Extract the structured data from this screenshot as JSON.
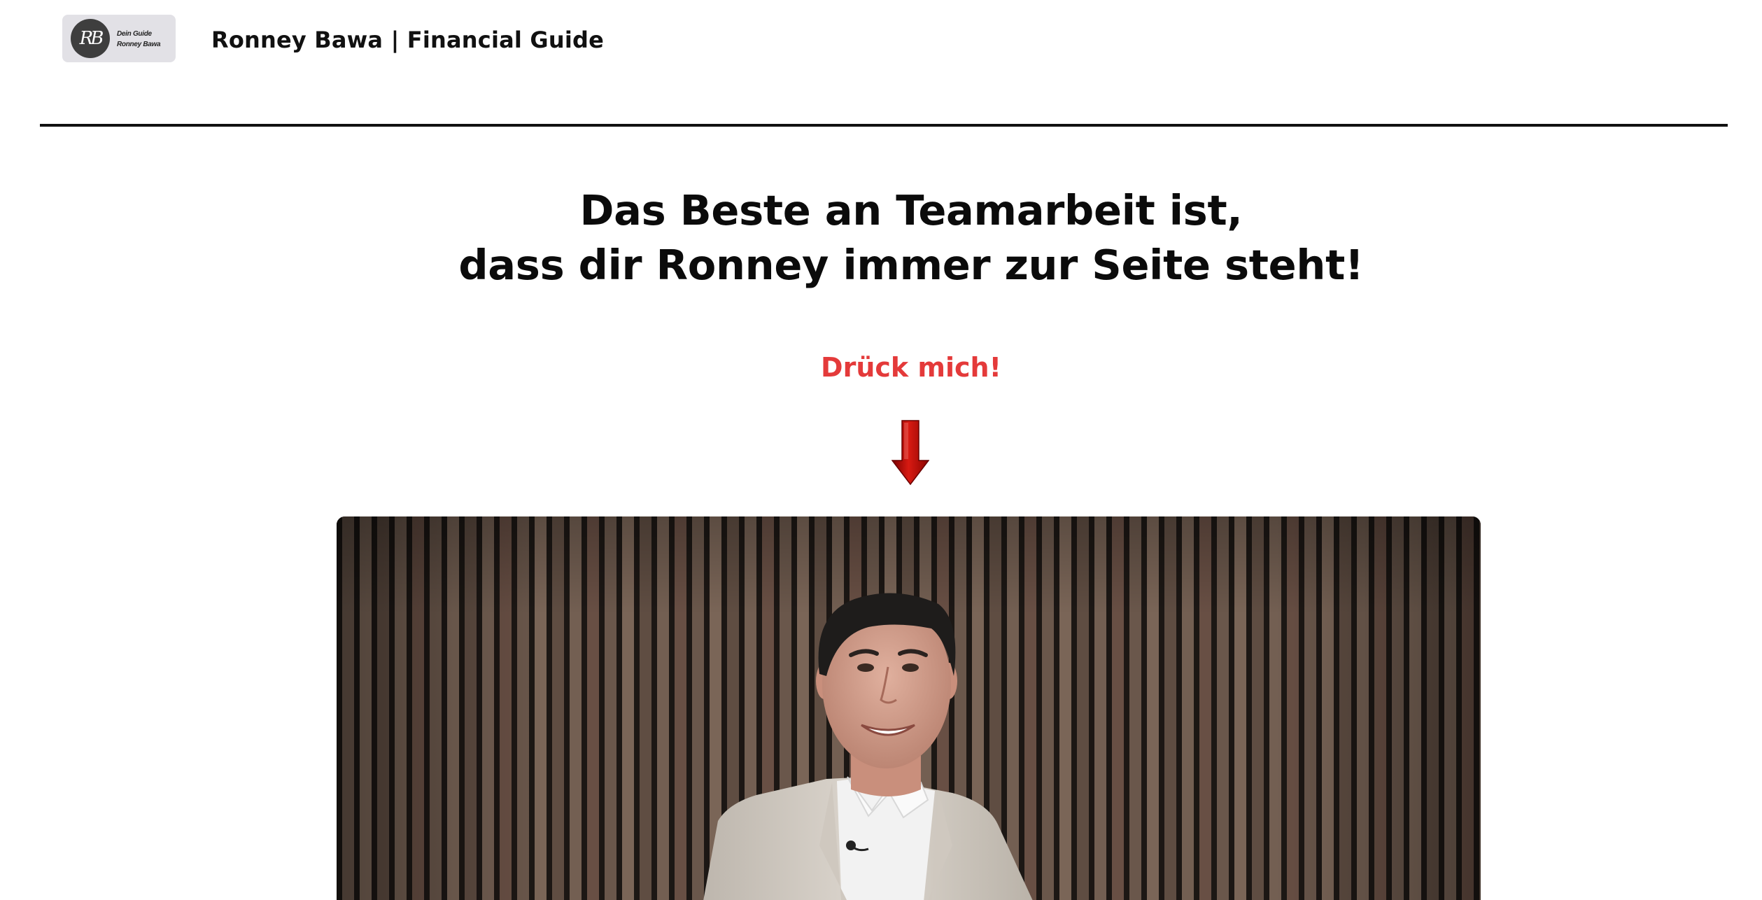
{
  "header": {
    "logo": {
      "monogram": "RB",
      "line1": "Dein Guide",
      "line2": "Ronney Bawa",
      "background": "#e2e1e6",
      "circle_color": "#3e3e3e"
    },
    "brand_title": "Ronney Bawa | Financial Guide"
  },
  "hero": {
    "headline_line1": "Das Beste an Teamarbeit ist,",
    "headline_line2": "dass dir Ronney immer zur Seite steht!",
    "cta_label": "Drück mich!",
    "cta_color": "#e43a3a",
    "arrow_icon": "arrow-down-icon",
    "arrow_color": "#c0100c"
  },
  "video": {
    "subject": "presenter-video-thumbnail",
    "background_icon": "wood-slat-wall"
  }
}
